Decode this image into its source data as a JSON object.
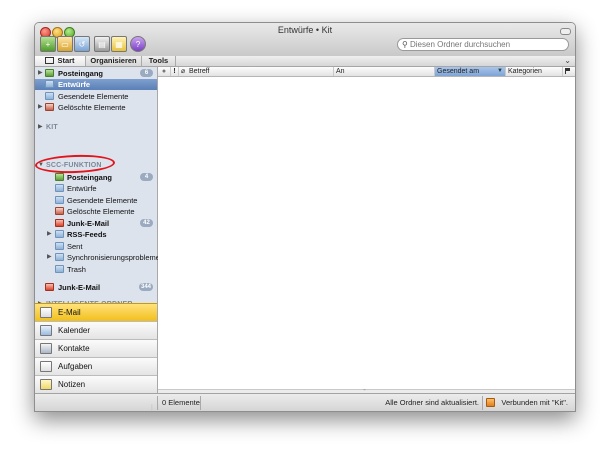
{
  "window": {
    "title": "Entwürfe • Kit"
  },
  "toolbar": {
    "icons": [
      "new-item-icon",
      "folder-icon",
      "reply-icon",
      "print-icon",
      "calendar-note-icon",
      "help-icon"
    ],
    "search_placeholder": "Diesen Ordner durchsuchen"
  },
  "ribbon": {
    "tabs": [
      "Start",
      "Organisieren",
      "Tools"
    ]
  },
  "sidebar": {
    "account1": {
      "inbox": "Posteingang",
      "inbox_count": "6",
      "drafts": "Entwürfe",
      "sent": "Gesendete Elemente",
      "deleted": "Gelöschte Elemente"
    },
    "kit_section": "KIT",
    "scc_section": "SCC-FUNKTION",
    "scc": {
      "inbox": "Posteingang",
      "inbox_count": "4",
      "drafts": "Entwürfe",
      "sent": "Gesendete Elemente",
      "deleted": "Gelöschte Elemente",
      "junk": "Junk-E-Mail",
      "junk_count": "42",
      "rss": "RSS-Feeds",
      "sent2": "Sent",
      "sync": "Synchronisierungsprobleme",
      "trash": "Trash"
    },
    "junk_global": "Junk-E-Mail",
    "junk_global_count": "344",
    "smart_section": "INTELLIGENTE ORDNER"
  },
  "nav": {
    "mail": "E-Mail",
    "calendar": "Kalender",
    "contacts": "Kontakte",
    "tasks": "Aufgaben",
    "notes": "Notizen"
  },
  "columns": {
    "status_icon": "●",
    "priority": "!",
    "attachment": "⌀",
    "subject": "Betreff",
    "to": "An",
    "sent_date": "Gesendet am",
    "categories": "Kategorien"
  },
  "status": {
    "count": "0 Elemente",
    "sync": "Alle Ordner sind aktualisiert.",
    "connection": "Verbunden mit \"Kit\"."
  },
  "colors": {
    "selection": "#5b80b6",
    "nav_active": "#f1bf1d",
    "annotation": "#e3141b"
  }
}
